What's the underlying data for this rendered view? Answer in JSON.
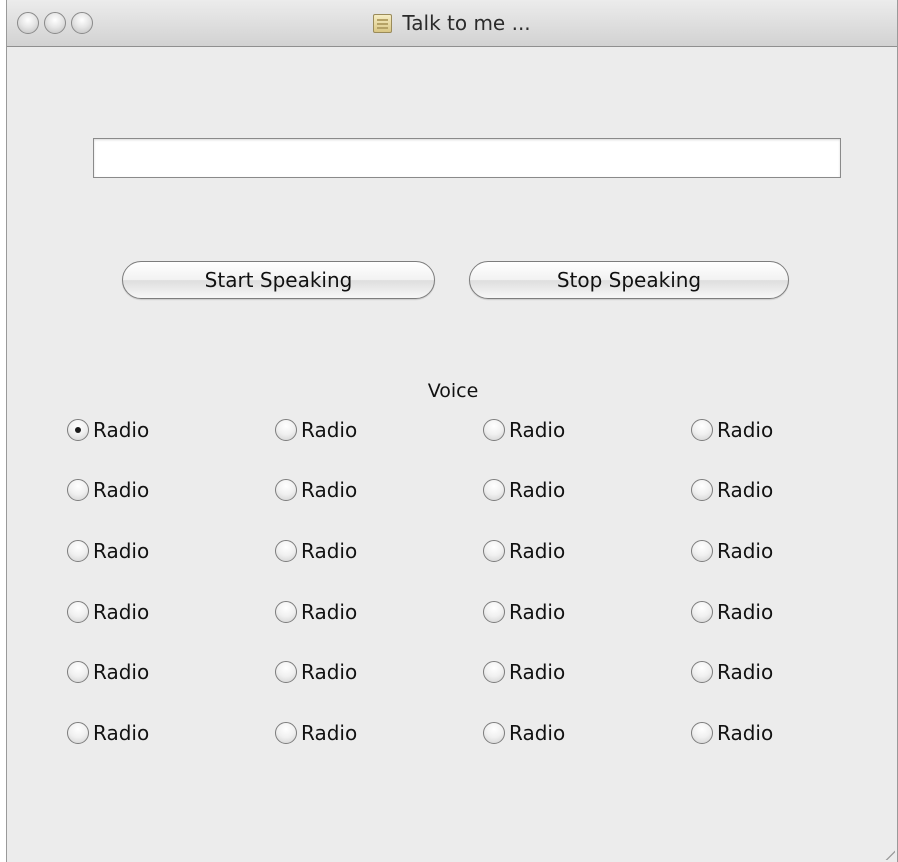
{
  "window": {
    "title": "Talk to me ...",
    "title_icon": "document-icon"
  },
  "text_input": {
    "value": "",
    "placeholder": ""
  },
  "buttons": {
    "start_label": "Start Speaking",
    "stop_label": "Stop Speaking"
  },
  "voice": {
    "label": "Voice",
    "selected_index": 0,
    "options": [
      "Radio",
      "Radio",
      "Radio",
      "Radio",
      "Radio",
      "Radio",
      "Radio",
      "Radio",
      "Radio",
      "Radio",
      "Radio",
      "Radio",
      "Radio",
      "Radio",
      "Radio",
      "Radio",
      "Radio",
      "Radio",
      "Radio",
      "Radio",
      "Radio",
      "Radio",
      "Radio",
      "Radio"
    ]
  },
  "colors": {
    "window_bg": "#ececec",
    "titlebar_top": "#ececec",
    "titlebar_bottom": "#d2d2d2"
  }
}
